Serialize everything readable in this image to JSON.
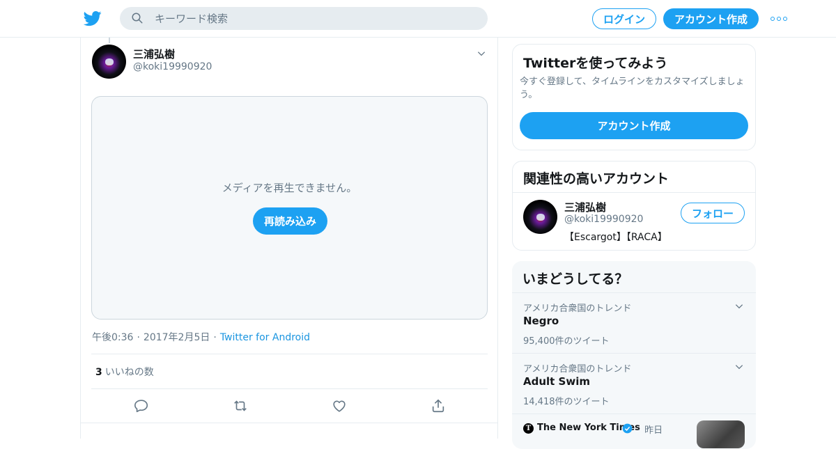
{
  "header": {
    "search_placeholder": "キーワード検索",
    "login_label": "ログイン",
    "signup_label": "アカウント作成"
  },
  "tweet": {
    "author_name": "三浦弘樹",
    "author_handle": "@koki19990920",
    "media_error": "メディアを再生できません。",
    "reload_label": "再読み込み",
    "time": "午後0:36",
    "date": "2017年2月5日",
    "source": "Twitter for Android",
    "like_count": "3",
    "like_label": "いいねの数"
  },
  "signup_card": {
    "title": "Twitterを使ってみよう",
    "description": "今すぐ登録して、タイムラインをカスタマイズしましょう。",
    "button_label": "アカウント作成"
  },
  "related": {
    "title": "関連性の高いアカウント",
    "accounts": [
      {
        "name": "三浦弘樹",
        "handle": "@koki19990920",
        "bio": "【Escargot】【RACA】",
        "follow_label": "フォロー"
      }
    ]
  },
  "trends": {
    "title": "いまどうしてる？",
    "items": [
      {
        "context": "アメリカ合衆国のトレンド",
        "name": "Negro",
        "count": "95,400件のツイート"
      },
      {
        "context": "アメリカ合衆国のトレンド",
        "name": "Adult Swim",
        "count": "14,418件のツイート"
      }
    ],
    "news": {
      "logo_letter": "T",
      "source": "The New York Times",
      "time": "昨日"
    }
  },
  "colors": {
    "accent": "#1da1f2",
    "muted": "#657786",
    "border": "#e6ecf0",
    "text": "#14171a"
  },
  "icons": [
    "twitter-logo-icon",
    "search-icon",
    "more-icon",
    "chevron-down-icon",
    "reply-icon",
    "retweet-icon",
    "like-icon",
    "share-icon",
    "verified-icon"
  ]
}
